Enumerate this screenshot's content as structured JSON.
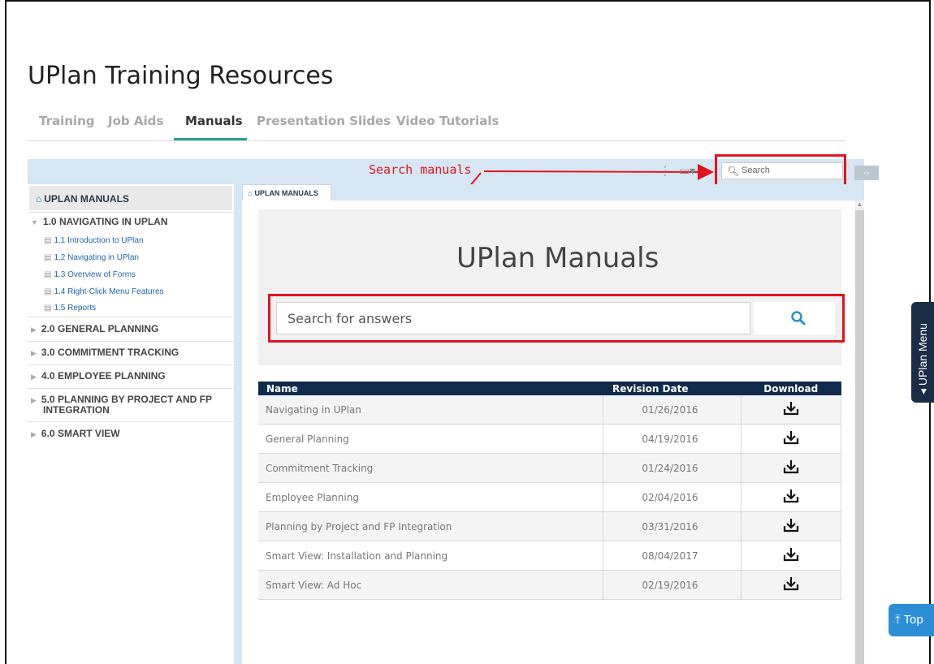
{
  "page": {
    "title": "UPlan Training Resources"
  },
  "tabs": [
    {
      "label": "Training"
    },
    {
      "label": "Job Aids"
    },
    {
      "label": "Manuals"
    },
    {
      "label": "Presentation Slides"
    },
    {
      "label": "Video Tutorials"
    }
  ],
  "active_tab": "Manuals",
  "annotation": {
    "label": "Search manuals"
  },
  "toolbar": {
    "search_placeholder": "Search"
  },
  "sidebar": {
    "header": "UPLAN MANUALS",
    "sections": [
      {
        "label": "1.0 NAVIGATING IN UPLAN",
        "expanded": true,
        "items": [
          {
            "label": "1.1 Introduction to UPlan"
          },
          {
            "label": "1.2 Navigating in UPlan"
          },
          {
            "label": "1.3 Overview of Forms"
          },
          {
            "label": "1.4 Right-Click Menu Features"
          },
          {
            "label": "1.5 Reports"
          }
        ]
      },
      {
        "label": "2.0 GENERAL PLANNING"
      },
      {
        "label": "3.0 COMMITMENT TRACKING"
      },
      {
        "label": "4.0 EMPLOYEE PLANNING"
      },
      {
        "label": "5.0 PLANNING BY PROJECT AND FP",
        "label2": "INTEGRATION"
      },
      {
        "label": "6.0 SMART VIEW"
      }
    ]
  },
  "content": {
    "tab_label": "UPLAN MANUALS",
    "hero_title": "UPlan Manuals",
    "search_placeholder": "Search for answers"
  },
  "table": {
    "columns": [
      "Name",
      "Revision Date",
      "Download"
    ],
    "rows": [
      {
        "name": "Navigating in UPlan",
        "date": "01/26/2016"
      },
      {
        "name": "General Planning",
        "date": "04/19/2016"
      },
      {
        "name": "Commitment Tracking",
        "date": "01/24/2016"
      },
      {
        "name": "Employee Planning",
        "date": "02/04/2016"
      },
      {
        "name": "Planning by Project and FP Integration",
        "date": "03/31/2016"
      },
      {
        "name": "Smart View: Installation and Planning",
        "date": "08/04/2017"
      },
      {
        "name": "Smart View: Ad Hoc",
        "date": "02/19/2016"
      }
    ]
  },
  "side_menu": {
    "label": "UPlan Menu"
  },
  "top_button": {
    "label": "Top"
  },
  "colors": {
    "accent": "#2a9d8f",
    "annotation": "#e0141e",
    "header_navy": "#102b4c",
    "top_button": "#2c8fd6"
  }
}
